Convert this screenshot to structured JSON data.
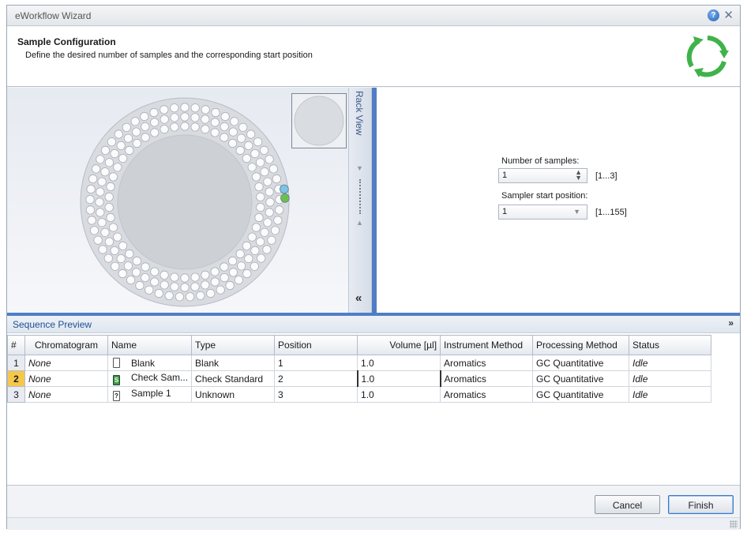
{
  "window": {
    "title": "eWorkflow Wizard"
  },
  "header": {
    "title": "Sample Configuration",
    "subtitle": "Define the desired number of samples and the corresponding start position"
  },
  "rack_view": {
    "tab_label": "Rack View",
    "collapse_glyph": "«"
  },
  "config": {
    "samples_label": "Number of samples:",
    "samples_value": "1",
    "samples_range": "[1...3]",
    "start_label": "Sampler start position:",
    "start_value": "1",
    "start_range": "[1...155]"
  },
  "sequence": {
    "title": "Sequence Preview",
    "columns": [
      "#",
      "Chromatogram",
      "Name",
      "Type",
      "Position",
      "Volume [µl]",
      "Instrument Method",
      "Processing Method",
      "Status"
    ],
    "rows": [
      {
        "num": "1",
        "chromatogram": "None",
        "icon_glyph": "",
        "name": "Blank",
        "type": "Blank",
        "position": "1",
        "volume": "1.0",
        "instrument_method": "Aromatics",
        "processing_method": "GC Quantitative",
        "status": "Idle"
      },
      {
        "num": "2",
        "chromatogram": "None",
        "icon_glyph": "S",
        "name": "Check Sam...",
        "type": "Check Standard",
        "position": "2",
        "volume": "1.0",
        "instrument_method": "Aromatics",
        "processing_method": "GC Quantitative",
        "status": "Idle"
      },
      {
        "num": "3",
        "chromatogram": "None",
        "icon_glyph": "?",
        "name": "Sample 1",
        "type": "Unknown",
        "position": "3",
        "volume": "1.0",
        "instrument_method": "Aromatics",
        "processing_method": "GC Quantitative",
        "status": "Idle"
      }
    ]
  },
  "buttons": {
    "cancel": "Cancel",
    "finish": "Finish"
  },
  "colors": {
    "accent": "#4f7ec4",
    "active_row": "#f5c84b",
    "refresh_green": "#3fb24a",
    "vial_blue": "#7ec3e8",
    "vial_green": "#6cc04a"
  }
}
